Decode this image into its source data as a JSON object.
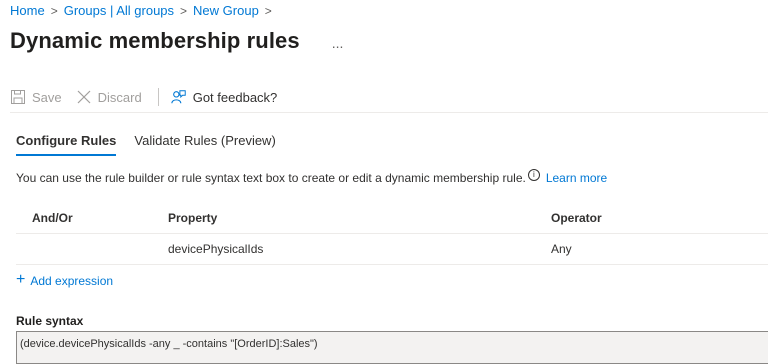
{
  "breadcrumb": {
    "items": [
      "Home",
      "Groups | All groups",
      "New Group"
    ],
    "separator": ">"
  },
  "title": "Dynamic membership rules",
  "more_icon": "...",
  "toolbar": {
    "save_label": "Save",
    "discard_label": "Discard",
    "feedback_label": "Got feedback?"
  },
  "tabs": [
    {
      "label": "Configure Rules",
      "selected": true
    },
    {
      "label": "Validate Rules (Preview)",
      "selected": false
    }
  ],
  "info": {
    "text": "You can use the rule builder or rule syntax text box to create or edit a dynamic membership rule.",
    "info_icon": "i",
    "link": "Learn more"
  },
  "table": {
    "headers": [
      "And/Or",
      "Property",
      "Operator"
    ],
    "rows": [
      {
        "and_or": "",
        "property": "devicePhysicalIds",
        "operator": "Any"
      }
    ]
  },
  "add_expression": {
    "icon": "+",
    "label": "Add expression"
  },
  "rule_syntax": {
    "label": "Rule syntax",
    "value": "(device.devicePhysicalIds -any _ -contains \"[OrderID]:Sales\")"
  },
  "colors": {
    "accent": "#0078d4",
    "text": "#323130"
  }
}
